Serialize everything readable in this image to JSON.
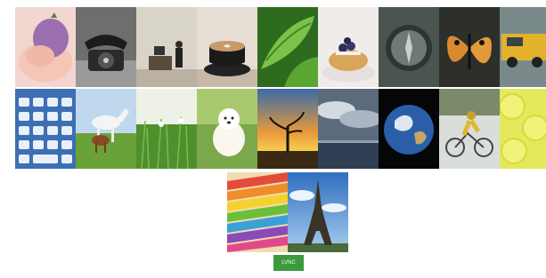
{
  "gallery": {
    "row1": [
      "baby",
      "rotary-phone",
      "office-desk",
      "latte-coffee",
      "green-leaves",
      "blueberry-waffles",
      "compass",
      "butterfly",
      "yellow-truck"
    ],
    "row2": [
      "keyboard",
      "horses",
      "meadow",
      "puppy",
      "sunset-tree",
      "ocean-clouds",
      "earth",
      "cyclist",
      "lemon-slices"
    ],
    "row3": [
      "colored-pencils",
      "eiffel-tower"
    ]
  },
  "actions": {
    "primary_label": "LVNC",
    "footnote": "..."
  },
  "colors": {
    "button": "#3c9a3c"
  }
}
